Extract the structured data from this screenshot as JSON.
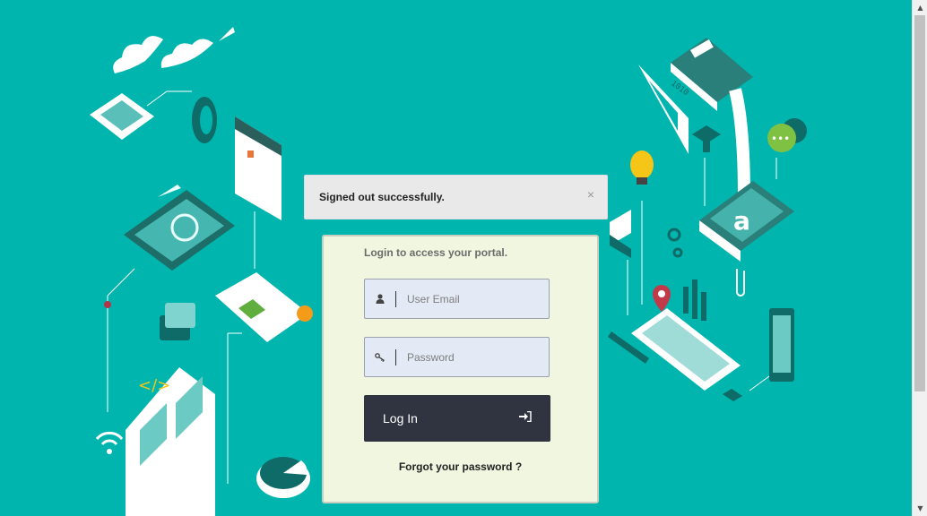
{
  "colors": {
    "background": "#00b5ad",
    "card": "#f0f6df",
    "button": "#2f3440",
    "alert": "#e9e9e9"
  },
  "alert": {
    "message": "Signed out successfully.",
    "close_label": "×"
  },
  "login": {
    "title": "Login to access your portal.",
    "email": {
      "placeholder": "User Email",
      "value": "",
      "icon": "user-icon"
    },
    "password": {
      "placeholder": "Password",
      "value": "",
      "icon": "key-icon"
    },
    "submit": {
      "label": "Log In",
      "icon": "sign-in-icon"
    },
    "forgot_label": "Forgot your password ?"
  },
  "illustration": {
    "letter_tile": "a",
    "book_label": "1010"
  }
}
